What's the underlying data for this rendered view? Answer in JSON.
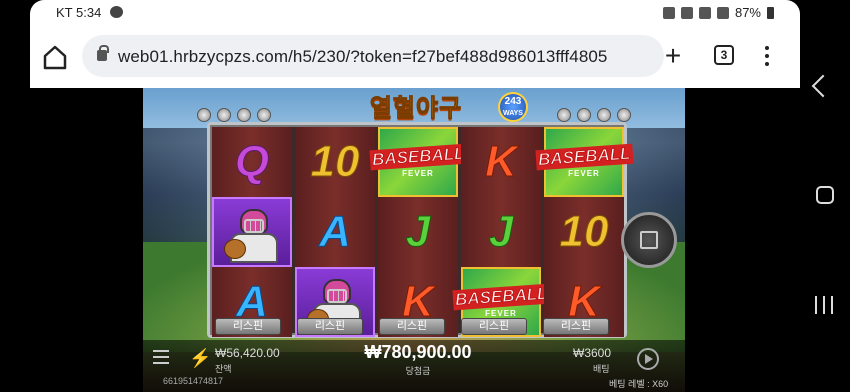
{
  "status_bar": {
    "carrier": "KT",
    "time": "5:34",
    "battery": "87%"
  },
  "browser": {
    "url": "web01.hrbzycpzs.com/h5/230/?token=f27bef488d986013fff4805",
    "tab_count": "3"
  },
  "game": {
    "title": "열혈야구",
    "ways_number": "243",
    "ways_label": "WAYS",
    "reels": [
      [
        "Q",
        "catcher",
        "A"
      ],
      [
        "10",
        "A",
        "catcher"
      ],
      [
        "baseball",
        "J",
        "K"
      ],
      [
        "K",
        "J",
        "baseball"
      ],
      [
        "baseball",
        "10",
        "K"
      ]
    ],
    "baseball_symbol": {
      "main": "BASEBALL",
      "sub": "FEVER"
    },
    "respin_labels": [
      "리스핀",
      "리스핀",
      "리스핀",
      "리스핀",
      "리스핀"
    ],
    "balance": "₩56,420.00",
    "balance_label": "잔액",
    "win_amount": "₩780,900.00",
    "win_label": "당첨금",
    "bet": "₩3600",
    "bet_label": "배팅",
    "round_id": "661951474817",
    "bet_level": "베팅 레벨 : X60"
  }
}
